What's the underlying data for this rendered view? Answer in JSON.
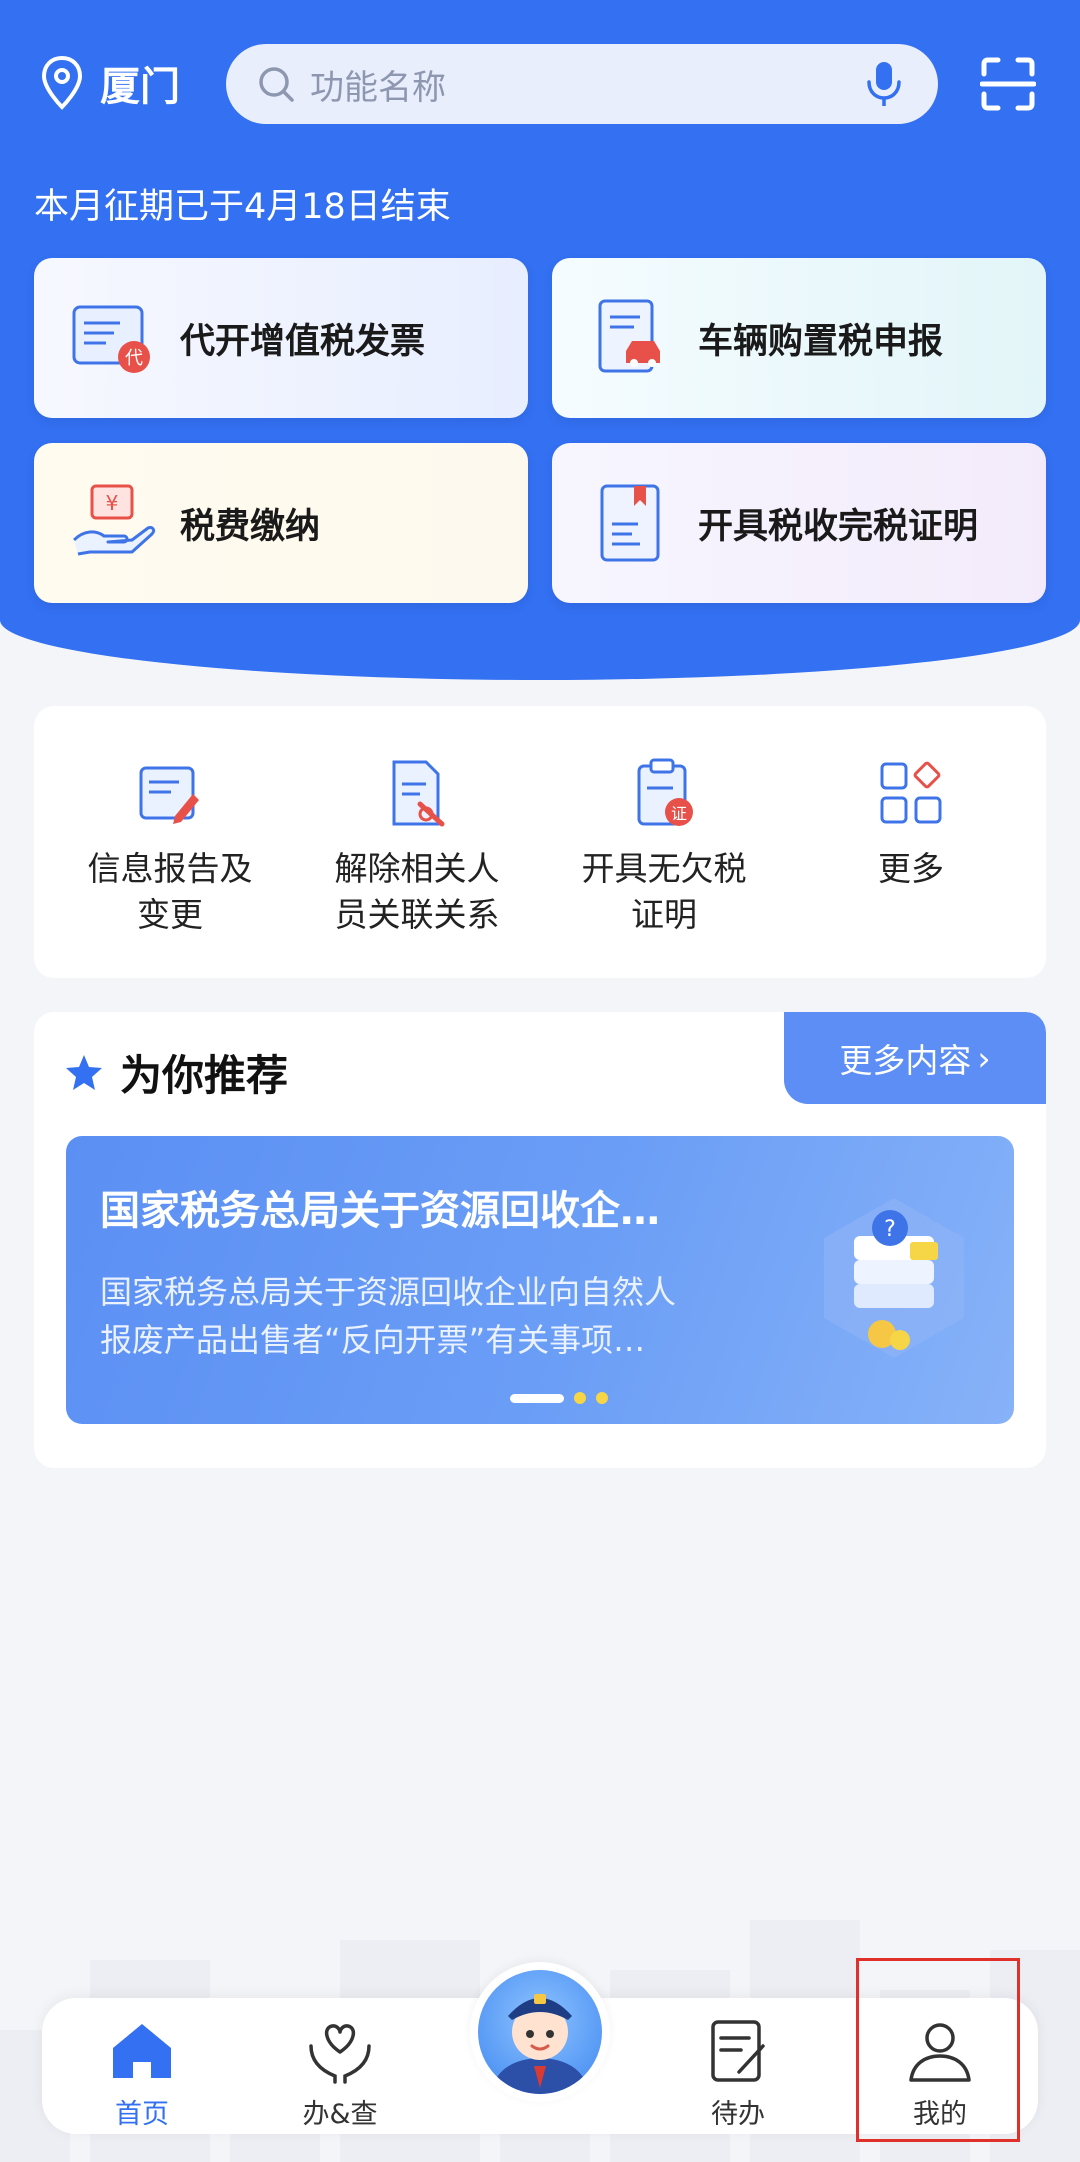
{
  "header": {
    "city": "厦门",
    "search_placeholder": "功能名称",
    "notice": "本月征期已于4月18日结束"
  },
  "services": [
    {
      "label": "代开增值税发票",
      "icon": "invoice-icon"
    },
    {
      "label": "车辆购置税申报",
      "icon": "vehicle-tax-icon"
    },
    {
      "label": "税费缴纳",
      "icon": "tax-payment-icon"
    },
    {
      "label": "开具税收完税证明",
      "icon": "tax-certificate-icon"
    }
  ],
  "quick": [
    {
      "line1": "信息报告及",
      "line2": "变更",
      "icon": "info-report-icon"
    },
    {
      "line1": "解除相关人",
      "line2": "员关联关系",
      "icon": "unlink-icon"
    },
    {
      "line1": "开具无欠税",
      "line2": "证明",
      "icon": "no-arrears-certificate-icon"
    },
    {
      "line1": "更多",
      "line2": "",
      "icon": "more-grid-icon"
    }
  ],
  "recommend": {
    "title": "为你推荐",
    "more": "更多内容",
    "banner_title": "国家税务总局关于资源回收企…",
    "banner_desc_line1": "国家税务总局关于资源回收企业向自然人",
    "banner_desc_line2": "报废产品出售者“反向开票”有关事项…",
    "carousel": {
      "current": 1,
      "total": 3
    }
  },
  "tabs": [
    {
      "label": "首页",
      "icon": "home-icon",
      "active": true
    },
    {
      "label": "办&查",
      "icon": "heart-hands-icon",
      "active": false
    },
    {
      "label": "待办",
      "icon": "todo-icon",
      "active": false
    },
    {
      "label": "我的",
      "icon": "user-icon",
      "active": false
    }
  ],
  "colors": {
    "primary": "#3370f2",
    "highlight_box": "#e0302a"
  }
}
